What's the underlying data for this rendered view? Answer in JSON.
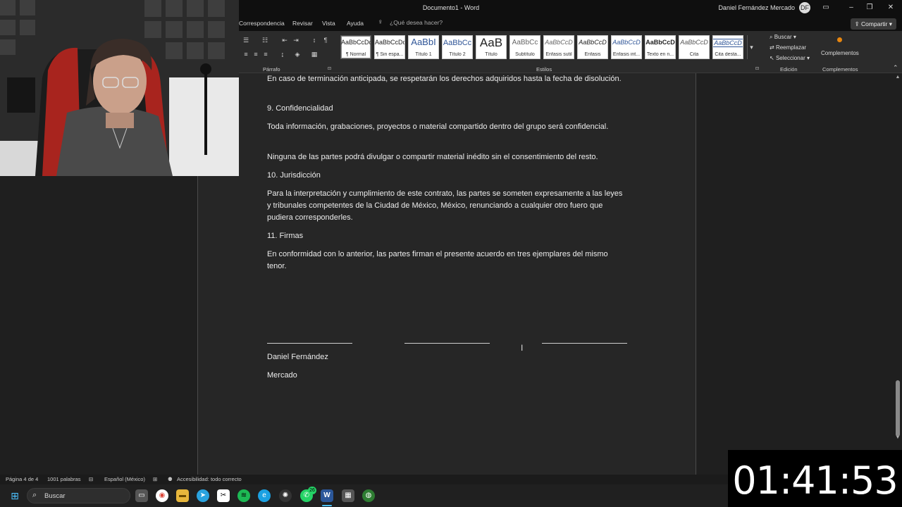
{
  "window": {
    "title": "Documento1 - Word",
    "user": "Daniel Fernández Mercado",
    "avatar_initials": "DF"
  },
  "ribbon_tabs": [
    "Correspondencia",
    "Revisar",
    "Vista",
    "Ayuda"
  ],
  "tell_me": {
    "placeholder": "¿Qué desea hacer?"
  },
  "share_button": "Compartir",
  "groups": {
    "parrafo": "Párrafo",
    "estilos": "Estilos",
    "edicion": "Edición",
    "complementos": "Complementos"
  },
  "styles": [
    {
      "sample": "AaBbCcDc",
      "name": "¶ Normal"
    },
    {
      "sample": "AaBbCcDc",
      "name": "¶ Sin espa..."
    },
    {
      "sample": "AaBbI",
      "name": "Título 1"
    },
    {
      "sample": "AaBbCc",
      "name": "Título 2"
    },
    {
      "sample": "AaB",
      "name": "Título"
    },
    {
      "sample": "AaBbCc",
      "name": "Subtítulo"
    },
    {
      "sample": "AaBbCcD",
      "name": "Énfasis sutil"
    },
    {
      "sample": "AaBbCcD",
      "name": "Énfasis"
    },
    {
      "sample": "AaBbCcD",
      "name": "Énfasis int..."
    },
    {
      "sample": "AaBbCcD",
      "name": "Texto en n..."
    },
    {
      "sample": "AaBbCcD",
      "name": "Cita"
    },
    {
      "sample": "AaBbCcD",
      "name": "Cita desta..."
    }
  ],
  "editing": {
    "find": "Buscar",
    "replace": "Reemplazar",
    "select": "Seleccionar"
  },
  "addins_button": "Complementos",
  "document": {
    "p1": "En caso de terminación anticipada, se respetarán los derechos adquiridos hasta la fecha de disolución.",
    "h9": "9. Confidencialidad",
    "p2": "Toda información, grabaciones, proyectos o material compartido dentro del grupo será confidencial.",
    "p3": "Ninguna de las partes podrá divulgar o compartir material inédito sin el consentimiento del resto.",
    "h10": "10. Jurisdicción",
    "p4": "Para la interpretación y cumplimiento de este contrato, las partes se someten expresamente a las leyes y tribunales competentes de la Ciudad de México, México, renunciando a cualquier otro fuero que pudiera corresponderles.",
    "h11": "11. Firmas",
    "p5": "En conformidad con lo anterior, las partes firman el presente acuerdo en tres ejemplares del mismo tenor.",
    "sig_name_1": "Daniel Fernández",
    "sig_name_2": "Mercado"
  },
  "statusbar": {
    "page": "Página 4 de 4",
    "words": "1001 palabras",
    "language": "Español (México)",
    "accessibility": "Accesibilidad: todo correcto"
  },
  "taskbar": {
    "search_label": "Buscar",
    "whatsapp_badge": "26"
  },
  "timer": "01:41:53"
}
